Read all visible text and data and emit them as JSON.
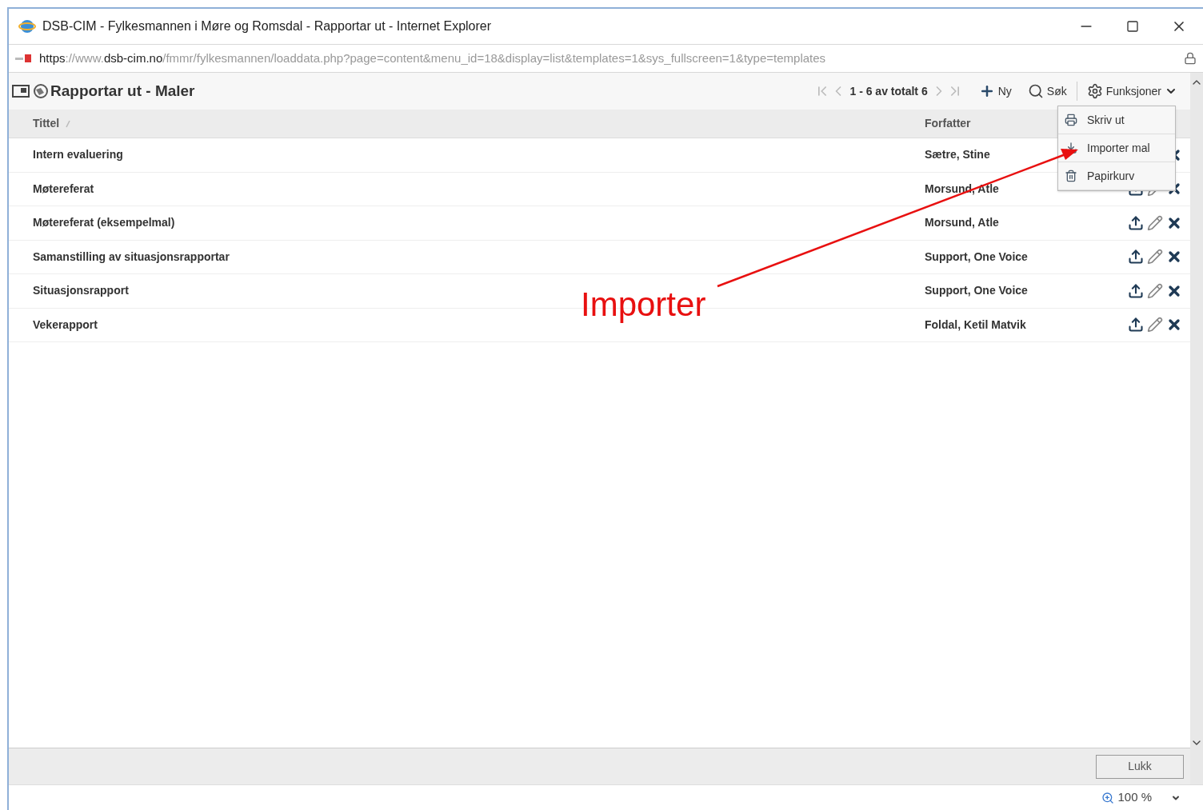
{
  "window": {
    "title": "DSB-CIM - Fylkesmannen i Møre og Romsdal - Rapportar ut - Internet Explorer"
  },
  "address_bar": {
    "parts": [
      {
        "text": "https",
        "strong": true
      },
      {
        "text": "://www.",
        "strong": false
      },
      {
        "text": "dsb-cim.no",
        "strong": true
      },
      {
        "text": "/fmmr/fylkesmannen/loaddata.php?page=content&menu_id=18&display=list&templates=1&sys_fullscreen=1&type=templates",
        "strong": false
      }
    ]
  },
  "panel": {
    "title": "Rapportar ut - Maler",
    "pager": "1 - 6 av totalt 6",
    "new_button": "Ny",
    "search_button": "Søk",
    "functions_button": "Funksjoner"
  },
  "table": {
    "columns": [
      "Tittel",
      "Forfatter"
    ],
    "rows": [
      {
        "title": "Intern evaluering",
        "author": "Sætre, Stine"
      },
      {
        "title": "Møtereferat",
        "author": "Morsund, Atle"
      },
      {
        "title": "Møtereferat (eksempelmal)",
        "author": "Morsund, Atle"
      },
      {
        "title": "Samanstilling av situasjonsrapportar",
        "author": "Support, One Voice"
      },
      {
        "title": "Situasjonsrapport",
        "author": "Support, One Voice"
      },
      {
        "title": "Vekerapport",
        "author": "Foldal, Ketil Matvik"
      }
    ]
  },
  "functions_menu": {
    "items": [
      {
        "kind": "print",
        "label": "Skriv ut"
      },
      {
        "kind": "import",
        "label": "Importer mal"
      },
      {
        "kind": "trash",
        "label": "Papirkurv"
      }
    ]
  },
  "annotation": {
    "text": "Importer"
  },
  "footer": {
    "close_button": "Lukk"
  },
  "status_bar": {
    "zoom": "100 %"
  }
}
